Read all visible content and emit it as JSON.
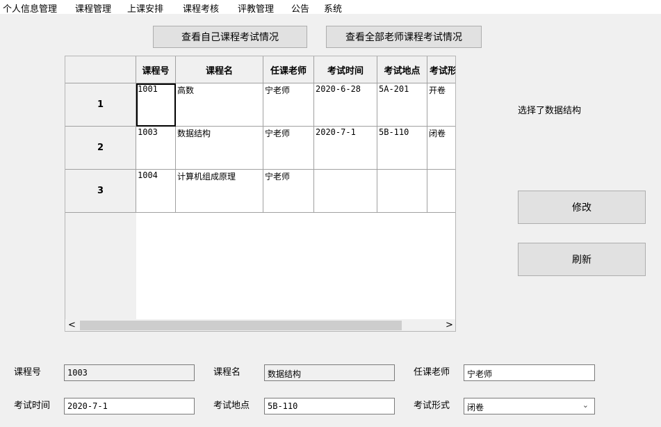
{
  "menu": [
    "个人信息管理",
    "课程管理",
    "上课安排",
    "课程考核",
    "评教管理",
    "公告",
    "系统"
  ],
  "buttons": {
    "view_own": "查看自己课程考试情况",
    "view_all": "查看全部老师课程考试情况",
    "modify": "修改",
    "refresh": "刷新"
  },
  "table": {
    "headers": [
      "课程号",
      "课程名",
      "任课老师",
      "考试时间",
      "考试地点",
      "考试形式"
    ],
    "rows": [
      {
        "num": "1",
        "cells": [
          "1001",
          "高数",
          "宁老师",
          "2020-6-28",
          "5A-201",
          "开卷"
        ]
      },
      {
        "num": "2",
        "cells": [
          "1003",
          "数据结构",
          "宁老师",
          "2020-7-1",
          "5B-110",
          "闭卷"
        ]
      },
      {
        "num": "3",
        "cells": [
          "1004",
          "计算机组成原理",
          "宁老师",
          "",
          "",
          ""
        ]
      }
    ]
  },
  "scrollbar": {
    "left_arrow": "<",
    "right_arrow": ">"
  },
  "status_text": "选择了数据结构",
  "form": {
    "course_no_label": "课程号",
    "course_no_value": "1003",
    "course_name_label": "课程名",
    "course_name_value": "数据结构",
    "teacher_label": "任课老师",
    "teacher_value": "宁老师",
    "exam_time_label": "考试时间",
    "exam_time_value": "2020-7-1",
    "exam_place_label": "考试地点",
    "exam_place_value": "5B-110",
    "exam_form_label": "考试形式",
    "exam_form_value": "闭卷"
  }
}
